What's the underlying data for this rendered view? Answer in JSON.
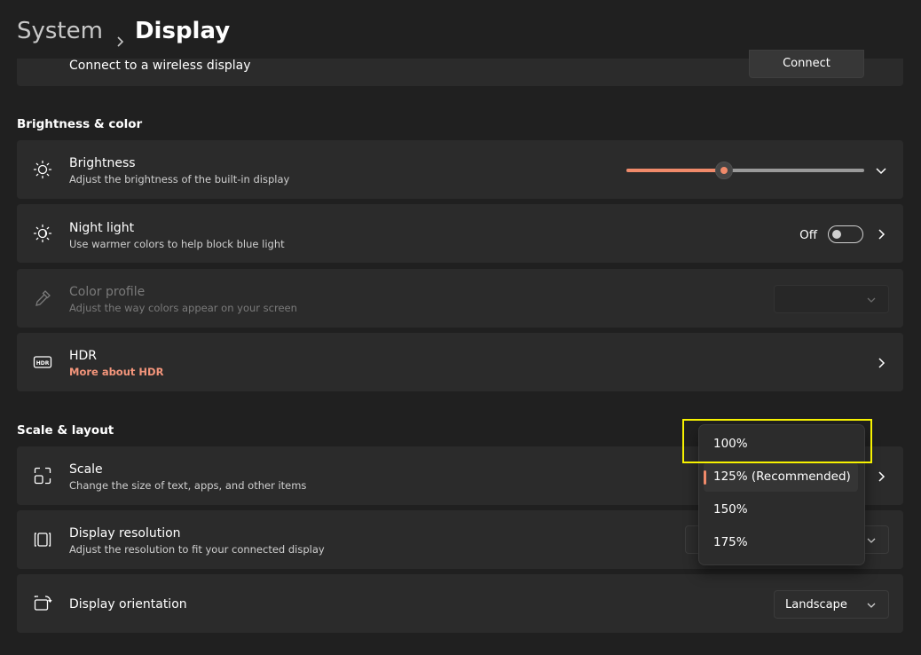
{
  "breadcrumb": {
    "parent": "System",
    "current": "Display"
  },
  "wireless": {
    "label": "Connect to a wireless display",
    "button": "Connect"
  },
  "sections": {
    "brightness_color": "Brightness & color",
    "scale_layout": "Scale & layout"
  },
  "brightness": {
    "title": "Brightness",
    "subtitle": "Adjust the brightness of the built-in display",
    "level_percent": 41
  },
  "night_light": {
    "title": "Night light",
    "subtitle": "Use warmer colors to help block blue light",
    "state": "Off"
  },
  "color_profile": {
    "title": "Color profile",
    "subtitle": "Adjust the way colors appear on your screen",
    "value": ""
  },
  "hdr": {
    "title": "HDR",
    "link": "More about HDR"
  },
  "scale": {
    "title": "Scale",
    "subtitle": "Change the size of text, apps, and other items"
  },
  "scale_dropdown": {
    "options": [
      "100%",
      "125% (Recommended)",
      "150%",
      "175%"
    ],
    "selected_index": 1,
    "highlighted_index": 0
  },
  "resolution": {
    "title": "Display resolution",
    "subtitle": "Adjust the resolution to fit your connected display"
  },
  "orientation": {
    "title": "Display orientation",
    "value": "Landscape"
  },
  "colors": {
    "accent": "#f08a6a",
    "link": "#f3957b",
    "highlight": "#f7f200",
    "background": "#202020",
    "card": "#2b2b2b"
  },
  "icons": {
    "brightness": "sun-icon",
    "night_light": "night-light-icon",
    "color_profile": "eyedropper-icon",
    "hdr": "hdr-icon",
    "scale": "scale-icon",
    "resolution": "resolution-icon",
    "orientation": "orientation-icon"
  }
}
